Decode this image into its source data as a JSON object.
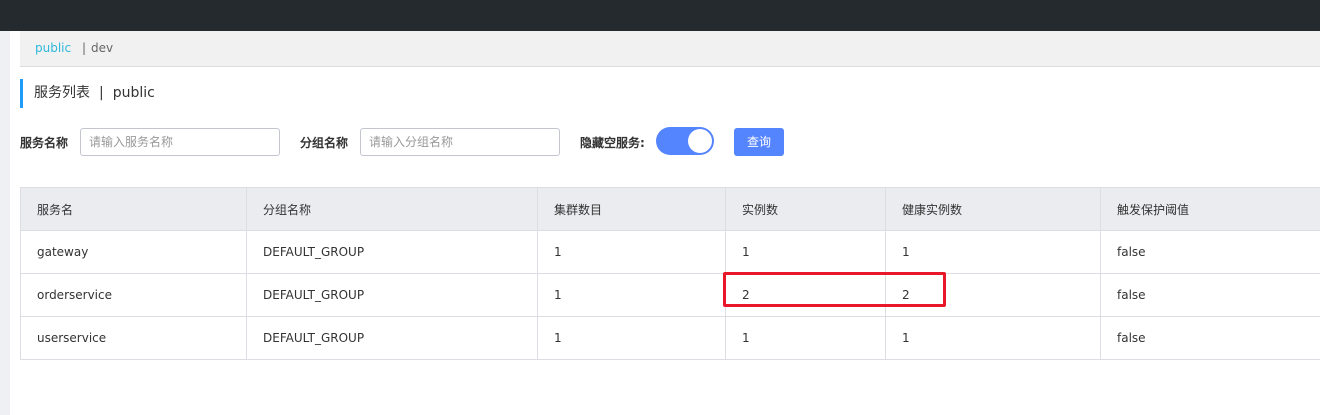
{
  "namespace": {
    "active": "public",
    "separator": "|",
    "other": "dev"
  },
  "page": {
    "title": "服务列表",
    "title_separator": "|",
    "namespace": "public"
  },
  "filters": {
    "service_name_label": "服务名称",
    "service_name_placeholder": "请输入服务名称",
    "service_name_value": "",
    "group_name_label": "分组名称",
    "group_name_placeholder": "请输入分组名称",
    "group_name_value": "",
    "hide_empty_label": "隐藏空服务:",
    "hide_empty_on": true,
    "query_button": "查询"
  },
  "table": {
    "columns": [
      "服务名",
      "分组名称",
      "集群数目",
      "实例数",
      "健康实例数",
      "触发保护阈值"
    ],
    "rows": [
      [
        "gateway",
        "DEFAULT_GROUP",
        "1",
        "1",
        "1",
        "false"
      ],
      [
        "orderservice",
        "DEFAULT_GROUP",
        "1",
        "2",
        "2",
        "false"
      ],
      [
        "userservice",
        "DEFAULT_GROUP",
        "1",
        "1",
        "1",
        "false"
      ]
    ]
  },
  "annotation": {
    "highlight_color": "#e8182a"
  },
  "colors": {
    "topbar": "#252a2f",
    "accent": "#5584ff",
    "namespace_active": "#2eb8db"
  }
}
